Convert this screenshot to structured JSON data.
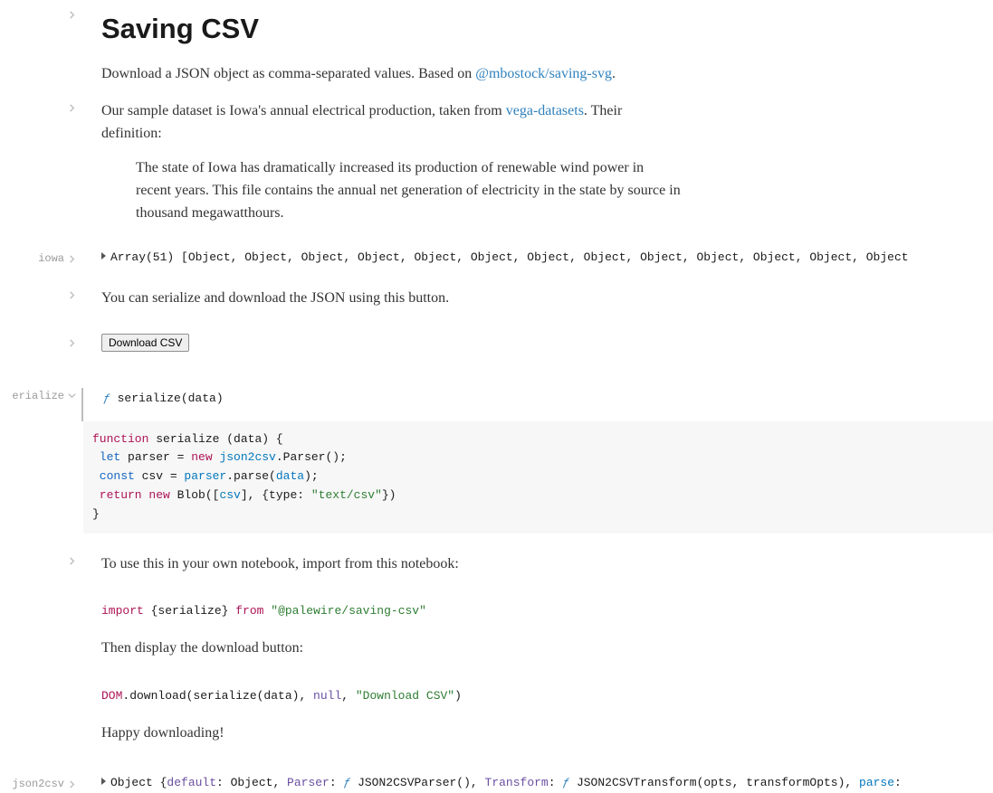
{
  "title": "Saving CSV",
  "intro_pre": "Download a JSON object as comma-separated values. Based on ",
  "intro_link": "@mbostock/saving-svg",
  "intro_post": ".",
  "sample_pre": "Our sample dataset is Iowa's annual electrical production, taken from ",
  "sample_link": "vega-datasets",
  "sample_post": ". Their definition:",
  "blockquote": "The state of Iowa has dramatically increased its production of renewable wind power in recent years. This file contains the annual net generation of electricity in the state by source in thousand megawatthours.",
  "iowa_label": "iowa",
  "iowa_output": "Array(51) [Object, Object, Object, Object, Object, Object, Object, Object, Object, Object, Object, Object, Object",
  "serialize_explain": "You can serialize and download the JSON using this button.",
  "download_button": "Download CSV",
  "serialize_label": "erialize",
  "fn_head_f": "ƒ",
  "fn_head_sig": " serialize(data)",
  "fn_body": {
    "l1a": "function",
    "l1b": " serialize (data) {",
    "l2a": " let",
    "l2b": " parser = ",
    "l2c": "new",
    "l2d": " ",
    "l2e": "json2csv",
    "l2f": ".Parser();",
    "l3a": " const",
    "l3b": " csv = ",
    "l3c": "parser",
    "l3d": ".parse(",
    "l3e": "data",
    "l3f": ");",
    "l4a": " return",
    "l4b": " ",
    "l4c": "new",
    "l4d": " Blob([",
    "l4e": "csv",
    "l4f": "], {type: ",
    "l4g": "\"text/csv\"",
    "l4h": "})",
    "l5": "}"
  },
  "use_in_notebook": "To use this in your own notebook, import from this notebook:",
  "import_line": {
    "a": "import",
    "b": " {serialize} ",
    "c": "from",
    "d": " ",
    "e": "\"@palewire/saving-csv\""
  },
  "then_display": "Then display the download button:",
  "dom_line": {
    "dom": "DOM",
    "a": ".download(serialize(data), ",
    "null": "null",
    "b": ", ",
    "str": "\"Download CSV\"",
    "c": ")"
  },
  "happy": "Happy downloading!",
  "json2csv_label": "json2csv",
  "json2csv_output": {
    "a": "Object {",
    "b": "default",
    "c": ": Object, ",
    "d": "Parser",
    "e": ": ",
    "f": "ƒ",
    "g": " JSON2CSVParser(), ",
    "h": "Transform",
    "i": ": ",
    "j": "ƒ",
    "k": " JSON2CSVTransform(opts, transformOpts), ",
    "l": "parse",
    "m": ": "
  }
}
